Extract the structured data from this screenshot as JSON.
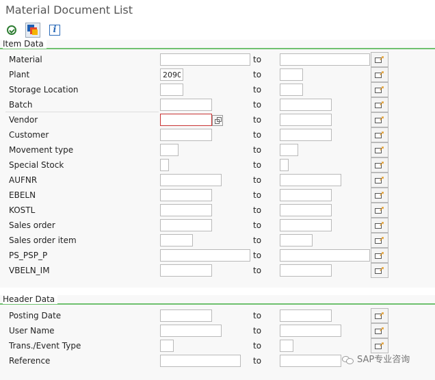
{
  "window": {
    "title": "Material Document List"
  },
  "toolbar": {
    "execute_icon": "execute-icon",
    "variant_icon": "get-variant-icon",
    "info_icon": "information-icon"
  },
  "item_section": {
    "title": "Item Data",
    "to_label": "to",
    "rows": [
      {
        "label": "Material",
        "from_value": "",
        "to_value": ""
      },
      {
        "label": "Plant",
        "from_value": "2090",
        "to_value": ""
      },
      {
        "label": "Storage Location",
        "from_value": "",
        "to_value": ""
      },
      {
        "label": "Batch",
        "from_value": "",
        "to_value": ""
      },
      {
        "label": "Vendor",
        "from_value": "",
        "to_value": ""
      },
      {
        "label": "Customer",
        "from_value": "",
        "to_value": ""
      },
      {
        "label": "Movement type",
        "from_value": "",
        "to_value": ""
      },
      {
        "label": "Special Stock",
        "from_value": "",
        "to_value": ""
      },
      {
        "label": "AUFNR",
        "from_value": "",
        "to_value": ""
      },
      {
        "label": "EBELN",
        "from_value": "",
        "to_value": ""
      },
      {
        "label": "KOSTL",
        "from_value": "",
        "to_value": ""
      },
      {
        "label": "Sales order",
        "from_value": "",
        "to_value": ""
      },
      {
        "label": "Sales order item",
        "from_value": "",
        "to_value": ""
      },
      {
        "label": "PS_PSP_P",
        "from_value": "",
        "to_value": ""
      },
      {
        "label": "VBELN_IM",
        "from_value": "",
        "to_value": ""
      }
    ]
  },
  "header_section": {
    "title": "Header Data",
    "to_label": "to",
    "rows": [
      {
        "label": "Posting Date",
        "from_value": "",
        "to_value": ""
      },
      {
        "label": "User Name",
        "from_value": "",
        "to_value": ""
      },
      {
        "label": "Trans./Event Type",
        "from_value": "",
        "to_value": ""
      },
      {
        "label": "Reference",
        "from_value": "",
        "to_value": ""
      }
    ]
  },
  "icons": {
    "multiple_selection": "multiple-selection-arrow-icon",
    "value_help": "value-help-icon"
  },
  "colors": {
    "section_rule": "#6ec06e",
    "required_border": "#c83232",
    "multi_sel_arrow": "#e08a00"
  },
  "watermark": {
    "text": "SAP专业咨询"
  }
}
